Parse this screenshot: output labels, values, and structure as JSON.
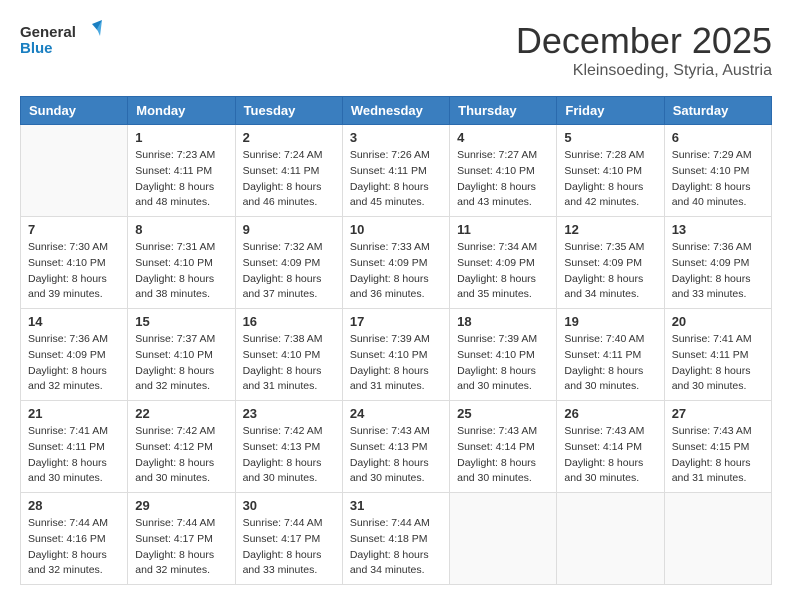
{
  "header": {
    "logo_general": "General",
    "logo_blue": "Blue",
    "month": "December 2025",
    "location": "Kleinsoeding, Styria, Austria"
  },
  "days_of_week": [
    "Sunday",
    "Monday",
    "Tuesday",
    "Wednesday",
    "Thursday",
    "Friday",
    "Saturday"
  ],
  "weeks": [
    [
      {
        "day": "",
        "sunrise": "",
        "sunset": "",
        "daylight": ""
      },
      {
        "day": "1",
        "sunrise": "Sunrise: 7:23 AM",
        "sunset": "Sunset: 4:11 PM",
        "daylight": "Daylight: 8 hours and 48 minutes."
      },
      {
        "day": "2",
        "sunrise": "Sunrise: 7:24 AM",
        "sunset": "Sunset: 4:11 PM",
        "daylight": "Daylight: 8 hours and 46 minutes."
      },
      {
        "day": "3",
        "sunrise": "Sunrise: 7:26 AM",
        "sunset": "Sunset: 4:11 PM",
        "daylight": "Daylight: 8 hours and 45 minutes."
      },
      {
        "day": "4",
        "sunrise": "Sunrise: 7:27 AM",
        "sunset": "Sunset: 4:10 PM",
        "daylight": "Daylight: 8 hours and 43 minutes."
      },
      {
        "day": "5",
        "sunrise": "Sunrise: 7:28 AM",
        "sunset": "Sunset: 4:10 PM",
        "daylight": "Daylight: 8 hours and 42 minutes."
      },
      {
        "day": "6",
        "sunrise": "Sunrise: 7:29 AM",
        "sunset": "Sunset: 4:10 PM",
        "daylight": "Daylight: 8 hours and 40 minutes."
      }
    ],
    [
      {
        "day": "7",
        "sunrise": "Sunrise: 7:30 AM",
        "sunset": "Sunset: 4:10 PM",
        "daylight": "Daylight: 8 hours and 39 minutes."
      },
      {
        "day": "8",
        "sunrise": "Sunrise: 7:31 AM",
        "sunset": "Sunset: 4:10 PM",
        "daylight": "Daylight: 8 hours and 38 minutes."
      },
      {
        "day": "9",
        "sunrise": "Sunrise: 7:32 AM",
        "sunset": "Sunset: 4:09 PM",
        "daylight": "Daylight: 8 hours and 37 minutes."
      },
      {
        "day": "10",
        "sunrise": "Sunrise: 7:33 AM",
        "sunset": "Sunset: 4:09 PM",
        "daylight": "Daylight: 8 hours and 36 minutes."
      },
      {
        "day": "11",
        "sunrise": "Sunrise: 7:34 AM",
        "sunset": "Sunset: 4:09 PM",
        "daylight": "Daylight: 8 hours and 35 minutes."
      },
      {
        "day": "12",
        "sunrise": "Sunrise: 7:35 AM",
        "sunset": "Sunset: 4:09 PM",
        "daylight": "Daylight: 8 hours and 34 minutes."
      },
      {
        "day": "13",
        "sunrise": "Sunrise: 7:36 AM",
        "sunset": "Sunset: 4:09 PM",
        "daylight": "Daylight: 8 hours and 33 minutes."
      }
    ],
    [
      {
        "day": "14",
        "sunrise": "Sunrise: 7:36 AM",
        "sunset": "Sunset: 4:09 PM",
        "daylight": "Daylight: 8 hours and 32 minutes."
      },
      {
        "day": "15",
        "sunrise": "Sunrise: 7:37 AM",
        "sunset": "Sunset: 4:10 PM",
        "daylight": "Daylight: 8 hours and 32 minutes."
      },
      {
        "day": "16",
        "sunrise": "Sunrise: 7:38 AM",
        "sunset": "Sunset: 4:10 PM",
        "daylight": "Daylight: 8 hours and 31 minutes."
      },
      {
        "day": "17",
        "sunrise": "Sunrise: 7:39 AM",
        "sunset": "Sunset: 4:10 PM",
        "daylight": "Daylight: 8 hours and 31 minutes."
      },
      {
        "day": "18",
        "sunrise": "Sunrise: 7:39 AM",
        "sunset": "Sunset: 4:10 PM",
        "daylight": "Daylight: 8 hours and 30 minutes."
      },
      {
        "day": "19",
        "sunrise": "Sunrise: 7:40 AM",
        "sunset": "Sunset: 4:11 PM",
        "daylight": "Daylight: 8 hours and 30 minutes."
      },
      {
        "day": "20",
        "sunrise": "Sunrise: 7:41 AM",
        "sunset": "Sunset: 4:11 PM",
        "daylight": "Daylight: 8 hours and 30 minutes."
      }
    ],
    [
      {
        "day": "21",
        "sunrise": "Sunrise: 7:41 AM",
        "sunset": "Sunset: 4:11 PM",
        "daylight": "Daylight: 8 hours and 30 minutes."
      },
      {
        "day": "22",
        "sunrise": "Sunrise: 7:42 AM",
        "sunset": "Sunset: 4:12 PM",
        "daylight": "Daylight: 8 hours and 30 minutes."
      },
      {
        "day": "23",
        "sunrise": "Sunrise: 7:42 AM",
        "sunset": "Sunset: 4:13 PM",
        "daylight": "Daylight: 8 hours and 30 minutes."
      },
      {
        "day": "24",
        "sunrise": "Sunrise: 7:43 AM",
        "sunset": "Sunset: 4:13 PM",
        "daylight": "Daylight: 8 hours and 30 minutes."
      },
      {
        "day": "25",
        "sunrise": "Sunrise: 7:43 AM",
        "sunset": "Sunset: 4:14 PM",
        "daylight": "Daylight: 8 hours and 30 minutes."
      },
      {
        "day": "26",
        "sunrise": "Sunrise: 7:43 AM",
        "sunset": "Sunset: 4:14 PM",
        "daylight": "Daylight: 8 hours and 30 minutes."
      },
      {
        "day": "27",
        "sunrise": "Sunrise: 7:43 AM",
        "sunset": "Sunset: 4:15 PM",
        "daylight": "Daylight: 8 hours and 31 minutes."
      }
    ],
    [
      {
        "day": "28",
        "sunrise": "Sunrise: 7:44 AM",
        "sunset": "Sunset: 4:16 PM",
        "daylight": "Daylight: 8 hours and 32 minutes."
      },
      {
        "day": "29",
        "sunrise": "Sunrise: 7:44 AM",
        "sunset": "Sunset: 4:17 PM",
        "daylight": "Daylight: 8 hours and 32 minutes."
      },
      {
        "day": "30",
        "sunrise": "Sunrise: 7:44 AM",
        "sunset": "Sunset: 4:17 PM",
        "daylight": "Daylight: 8 hours and 33 minutes."
      },
      {
        "day": "31",
        "sunrise": "Sunrise: 7:44 AM",
        "sunset": "Sunset: 4:18 PM",
        "daylight": "Daylight: 8 hours and 34 minutes."
      },
      {
        "day": "",
        "sunrise": "",
        "sunset": "",
        "daylight": ""
      },
      {
        "day": "",
        "sunrise": "",
        "sunset": "",
        "daylight": ""
      },
      {
        "day": "",
        "sunrise": "",
        "sunset": "",
        "daylight": ""
      }
    ]
  ]
}
